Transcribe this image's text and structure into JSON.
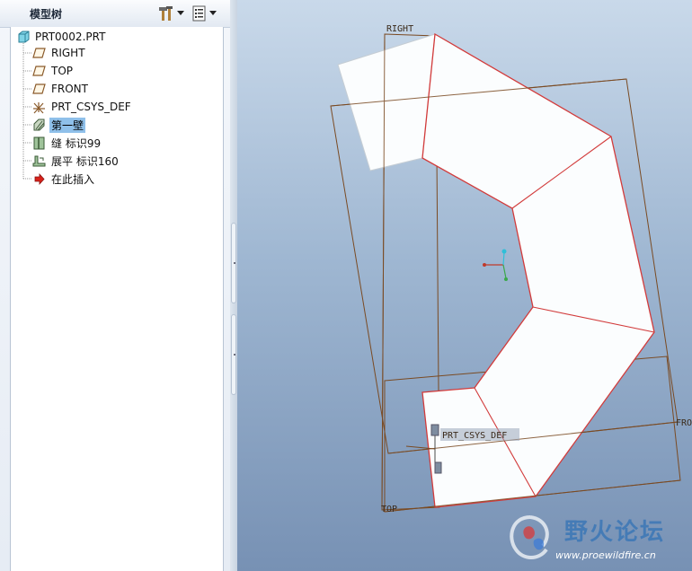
{
  "panel": {
    "title": "模型树"
  },
  "tree": {
    "root": "PRT0002.PRT",
    "items": [
      {
        "label": "RIGHT",
        "icon": "datum-plane-icon"
      },
      {
        "label": "TOP",
        "icon": "datum-plane-icon"
      },
      {
        "label": "FRONT",
        "icon": "datum-plane-icon"
      },
      {
        "label": "PRT_CSYS_DEF",
        "icon": "coordinate-system-icon"
      },
      {
        "label": "第一壁",
        "icon": "sheetmetal-wall-icon",
        "selected": true
      },
      {
        "label": "缝 标识99",
        "icon": "rip-icon"
      },
      {
        "label": "展平 标识160",
        "icon": "unbend-icon"
      },
      {
        "label": "在此插入",
        "icon": "insert-here-arrow-icon"
      }
    ]
  },
  "viewport": {
    "labels": {
      "right": "RIGHT",
      "top": "TOP",
      "front": "FRO",
      "csys": "PRT_CSYS_DEF"
    },
    "colors": {
      "edge": "#d23b3b",
      "datum": "#7a4a22",
      "surface": "#fbfdfe"
    }
  },
  "watermark": {
    "title": "野火论坛",
    "url": "www.proewildfire.cn"
  }
}
